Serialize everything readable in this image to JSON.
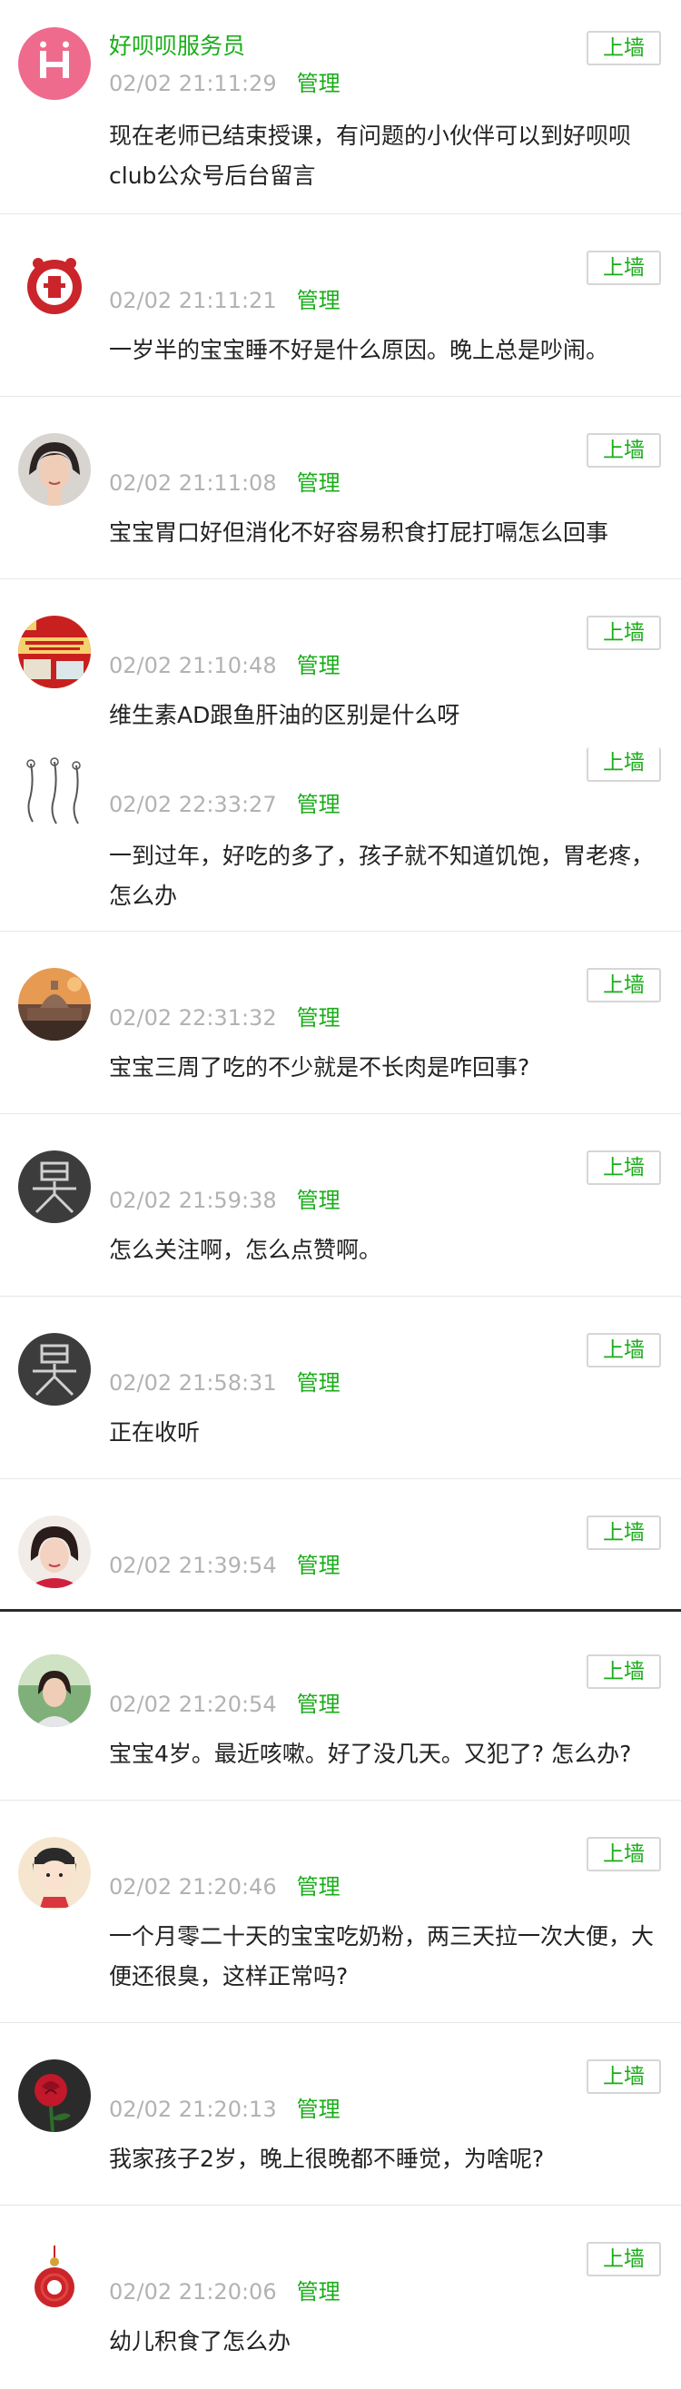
{
  "comments": [
    {
      "nickname": "好呗呗服务员",
      "time": "02/02 21:11:29",
      "manage": "管理",
      "text": "现在老师已结束授课，有问题的小伙伴可以到好呗呗club公众号后台留言",
      "button": "上墙",
      "avatar_icon": "brand-h-icon"
    },
    {
      "nickname": "",
      "time": "02/02 21:11:21",
      "manage": "管理",
      "text": "一岁半的宝宝睡不好是什么原因。晚上总是吵闹。",
      "button": "上墙",
      "avatar_icon": "paper-cut-fu-icon"
    },
    {
      "nickname": "",
      "time": "02/02 21:11:08",
      "manage": "管理",
      "text": "宝宝胃口好但消化不好容易积食打屁打嗝怎么回事",
      "button": "上墙",
      "avatar_icon": "woman-portrait-icon"
    },
    {
      "nickname": "",
      "time": "02/02 21:10:48",
      "manage": "管理",
      "text": "维生素AD跟鱼肝油的区别是什么呀",
      "button": "上墙",
      "avatar_icon": "red-banner-icon"
    },
    {
      "nickname": "",
      "time": "02/02 22:33:27",
      "manage": "管理",
      "text": "一到过年，好吃的多了，孩子就不知道饥饱，胃老疼，怎么办",
      "button": "上墙",
      "avatar_icon": "sketch-figures-icon"
    },
    {
      "nickname": "",
      "time": "02/02 22:31:32",
      "manage": "管理",
      "text": "宝宝三周了吃的不少就是不长肉是咋回事?",
      "button": "上墙",
      "avatar_icon": "cathedral-icon"
    },
    {
      "nickname": "",
      "time": "02/02 21:59:38",
      "manage": "管理",
      "text": "怎么关注啊，怎么点赞啊。",
      "button": "上墙",
      "avatar_icon": "character-wu-icon"
    },
    {
      "nickname": "",
      "time": "02/02 21:58:31",
      "manage": "管理",
      "text": "正在收听",
      "button": "上墙",
      "avatar_icon": "character-wu-icon"
    },
    {
      "nickname": "",
      "time": "02/02 21:39:54",
      "manage": "管理",
      "text": "",
      "button": "上墙",
      "avatar_icon": "woman-red-portrait-icon"
    },
    {
      "nickname": "",
      "time": "02/02 21:20:54",
      "manage": "管理",
      "text": "宝宝4岁。最近咳嗽。好了没几天。又犯了? 怎么办?",
      "button": "上墙",
      "avatar_icon": "woman-outdoor-icon"
    },
    {
      "nickname": "",
      "time": "02/02 21:20:46",
      "manage": "管理",
      "text": "一个月零二十天的宝宝吃奶粉，两三天拉一次大便，大便还很臭，这样正常吗?",
      "button": "上墙",
      "avatar_icon": "cartoon-girl-icon"
    },
    {
      "nickname": "",
      "time": "02/02 21:20:13",
      "manage": "管理",
      "text": "我家孩子2岁，晚上很晚都不睡觉，为啥呢?",
      "button": "上墙",
      "avatar_icon": "rose-icon"
    },
    {
      "nickname": "",
      "time": "02/02 21:20:06",
      "manage": "管理",
      "text": "幼儿积食了怎么办",
      "button": "上墙",
      "avatar_icon": "red-charm-icon"
    }
  ]
}
